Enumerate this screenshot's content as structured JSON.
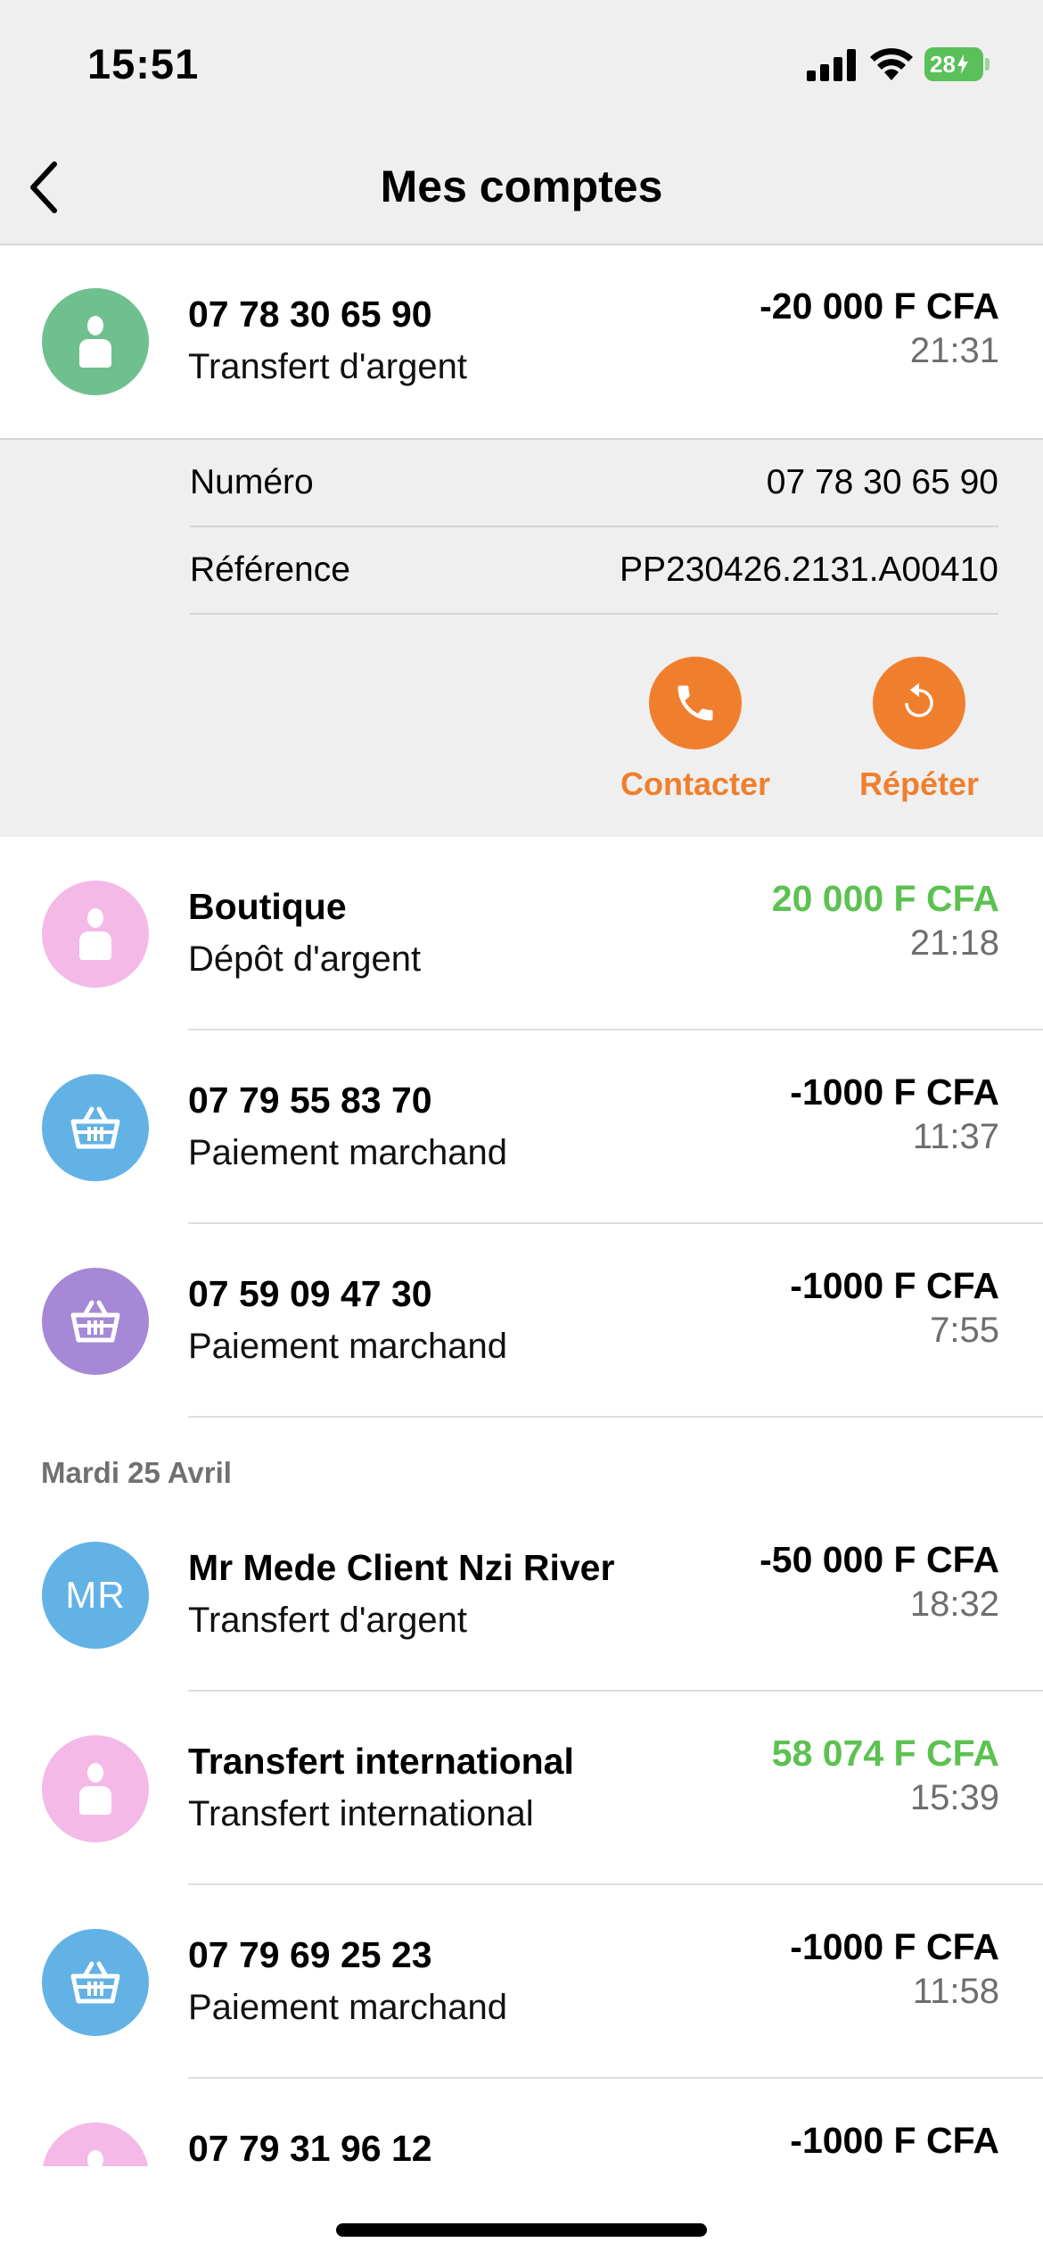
{
  "status_bar": {
    "time": "15:51",
    "battery": "28"
  },
  "header": {
    "title": "Mes comptes"
  },
  "expanded": {
    "name": "07 78 30 65 90",
    "type": "Transfert d'argent",
    "amount": "-20 000 F CFA",
    "time": "21:31",
    "details": {
      "numero_label": "Numéro",
      "numero_value": "07 78 30 65 90",
      "reference_label": "Référence",
      "reference_value": "PP230426.2131.A00410"
    },
    "actions": {
      "contact_label": "Contacter",
      "repeat_label": "Répéter"
    }
  },
  "transactions_today": [
    {
      "name": "Boutique",
      "type": "Dépôt d'argent",
      "amount": "20 000 F CFA",
      "time": "21:18"
    },
    {
      "name": "07 79 55 83 70",
      "type": "Paiement marchand",
      "amount": "-1000 F CFA",
      "time": "11:37"
    },
    {
      "name": "07 59 09 47 30",
      "type": "Paiement marchand",
      "amount": "-1000 F CFA",
      "time": "7:55"
    }
  ],
  "section_label": "Mardi 25 Avril",
  "transactions_previous": [
    {
      "name": "Mr Mede Client Nzi River",
      "type": "Transfert d'argent",
      "amount": "-50 000 F CFA",
      "time": "18:32",
      "initials": "MR"
    },
    {
      "name": "Transfert international",
      "type": "Transfert international",
      "amount": "58 074 F CFA",
      "time": "15:39"
    },
    {
      "name": "07 79 69 25 23",
      "type": "Paiement marchand",
      "amount": "-1000 F CFA",
      "time": "11:58"
    },
    {
      "name": "07 79 31 96 12",
      "type": "",
      "amount": "-1000 F CFA",
      "time": ""
    }
  ],
  "colors": {
    "green_avatar": "#6fc08e",
    "pink_avatar": "#f4b9e6",
    "blue_avatar": "#62b2e6",
    "purple_avatar": "#a589d6",
    "accent_orange": "#f07f2d",
    "positive_green": "#5cc151"
  }
}
